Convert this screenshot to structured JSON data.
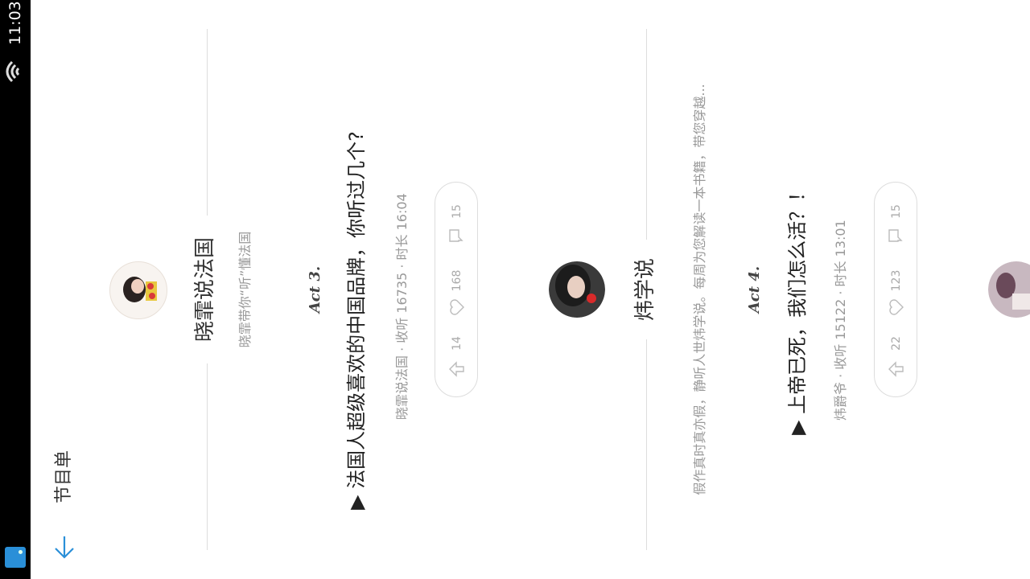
{
  "status_bar": {
    "time": "11:03"
  },
  "header": {
    "title": "节目单"
  },
  "sections": [
    {
      "name": "晓霏说法国",
      "subtitle": "晓霏带你“听”懂法国",
      "act": "Act 3.",
      "episode_title": "▶ 法国人超级喜欢的中国品牌，你听过几个?",
      "meta": "晓霏说法国 · 收听 16735 · 时长 16:04",
      "shares": "14",
      "likes": "168",
      "comments": "15"
    },
    {
      "name": "炜学说",
      "subtitle": "假作真时真亦假，静听人世炜学说。每周为您解读一本书籍，带您穿越...",
      "act": "Act 4.",
      "episode_title": "▶ 上帝已死，我们怎么活？！",
      "meta": "炜爵爷 · 收听 15122 · 时长 13:01",
      "shares": "22",
      "likes": "123",
      "comments": "15"
    }
  ],
  "icons": {
    "back": "down-arrow-icon",
    "share": "share-icon",
    "like": "heart-icon",
    "comment": "comment-icon",
    "wifi": "wifi-icon"
  },
  "colors": {
    "accent": "#2a8fd8",
    "text": "#333333",
    "muted": "#999999"
  }
}
